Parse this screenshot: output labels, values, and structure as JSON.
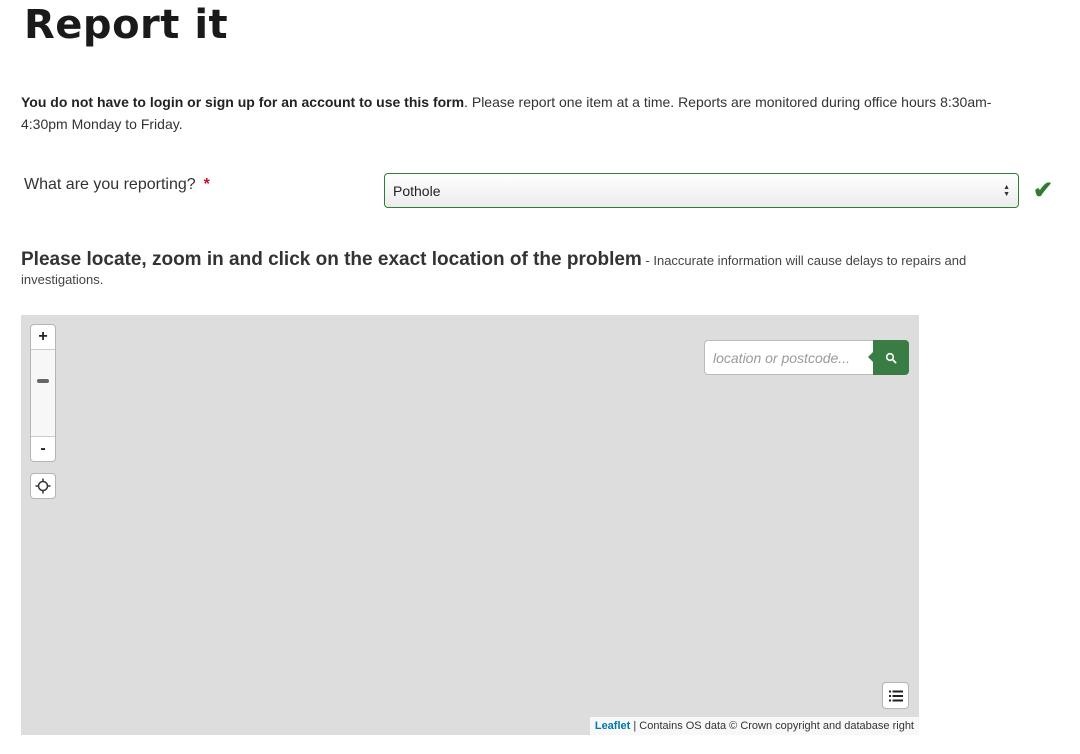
{
  "page": {
    "title": "Report it",
    "intro_bold": "You do not have to login or sign up for an account to use this form",
    "intro_rest": ". Please report one item at a time. Reports are monitored during office hours 8:30am-4:30pm Monday to Friday."
  },
  "form": {
    "reporting_label": "What are you reporting?",
    "required_marker": "*",
    "reporting_value": "Pothole",
    "valid_icon": "check-icon"
  },
  "location_section": {
    "heading": "Please locate, zoom in and click on the exact location of the problem",
    "note": " - Inaccurate information will cause delays to repairs and investigations."
  },
  "map": {
    "zoom_in_label": "+",
    "zoom_out_label": "-",
    "zoom_level_fraction": 0.35,
    "search_placeholder": "location or postcode...",
    "search_icon": "search-icon",
    "locate_icon": "crosshair-icon",
    "layers_icon": "layers-icon",
    "attribution_link": "Leaflet",
    "attribution_text": " | Contains OS data © Crown copyright and database right"
  },
  "colors": {
    "accent_green": "#3a7d44",
    "valid_green": "#2e7d32",
    "required_red": "#c8102e",
    "map_background": "#dddddd",
    "link_blue": "#0078a8"
  }
}
